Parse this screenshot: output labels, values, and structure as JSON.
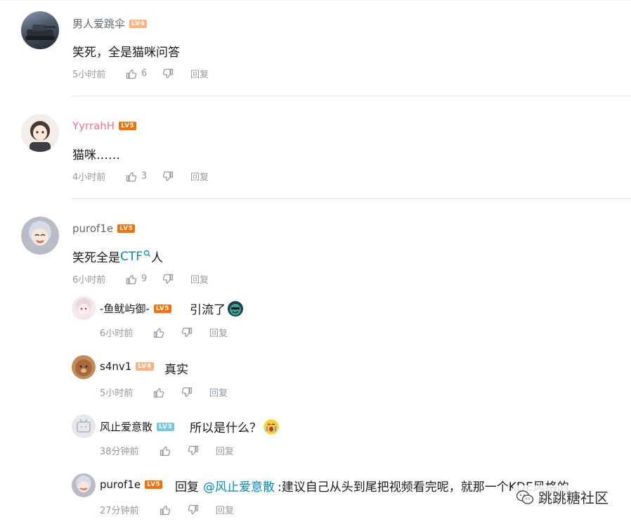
{
  "comments": [
    {
      "user": "男人爱跳伞",
      "level": "LV4",
      "text": "笑死，全是猫咪问答",
      "time": "5小时前",
      "likes": "6",
      "reply": "回复"
    },
    {
      "user": "YyrrahH",
      "level": "LV5",
      "text": "猫咪……",
      "time": "4小时前",
      "likes": "3",
      "reply": "回复"
    },
    {
      "user": "purof1e",
      "level": "LV5",
      "text_before": "笑死全是",
      "link": "CTF",
      "text_after": "人",
      "time": "6小时前",
      "likes": "9",
      "reply": "回复"
    }
  ],
  "replies": [
    {
      "user": "-鱼鱿屿御-",
      "level": "LV5",
      "text": "引流了",
      "time": "6小时前",
      "reply": "回复"
    },
    {
      "user": "s4nv1",
      "level": "LV4",
      "text": "真实",
      "time": "5小时前",
      "reply": "回复"
    },
    {
      "user": "风止爱意散",
      "level": "LV3",
      "text": "所以是什么？",
      "time": "38分钟前",
      "reply": "回复"
    },
    {
      "user": "purof1e",
      "level": "LV5",
      "reply_prefix": "回复",
      "mention": "@风止爱意散",
      "text": ":建议自己从头到尾把视频看完呢，就那一个KDE风格的",
      "time": "27分钟前",
      "reply": "回复"
    }
  ],
  "watermark": "跳跳糖社区",
  "colors": {
    "lv3": "#73c9e5",
    "lv4": "#ffb27f",
    "lv5": "#ff6c00",
    "link": "#008ac5",
    "pink_name": "#fb7299"
  },
  "icons": [
    "thumbs-up-icon",
    "thumbs-down-icon",
    "search-icon",
    "wechat-icon"
  ]
}
